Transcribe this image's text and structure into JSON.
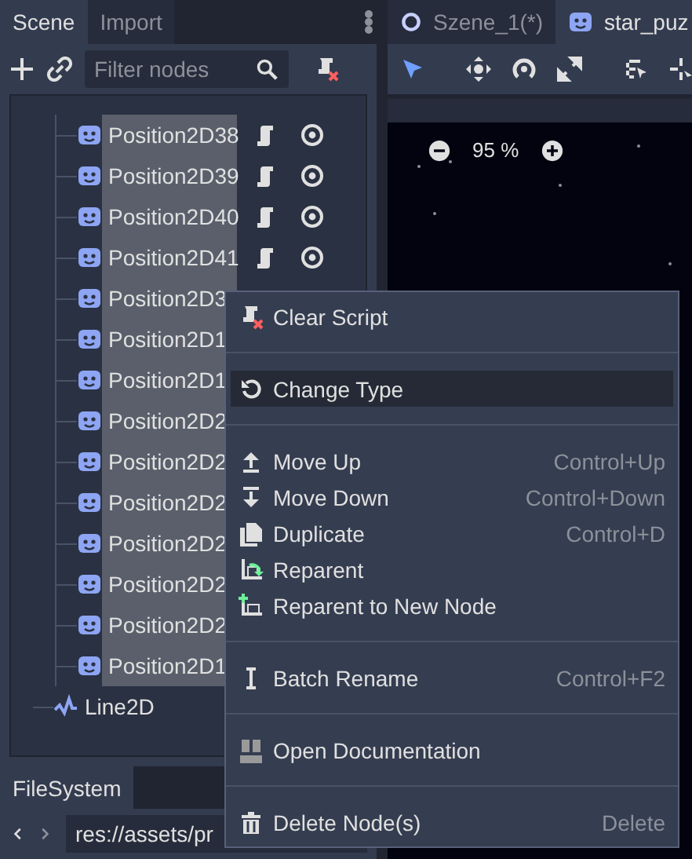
{
  "scene_panel": {
    "tabs": [
      {
        "label": "Scene",
        "selected": true
      },
      {
        "label": "Import",
        "selected": false
      }
    ],
    "filter": {
      "placeholder": "Filter nodes"
    },
    "tree": [
      {
        "kind": "group",
        "children": [
          {
            "name": "Position2D38",
            "selected": true,
            "script": true,
            "visible": true
          },
          {
            "name": "Position2D39",
            "selected": true,
            "script": true,
            "visible": true
          },
          {
            "name": "Position2D40",
            "selected": true,
            "script": true,
            "visible": true
          },
          {
            "name": "Position2D41",
            "selected": true,
            "script": true,
            "visible": true
          },
          {
            "name": "Position2D3",
            "selected": true
          },
          {
            "name": "Position2D1",
            "selected": true
          },
          {
            "name": "Position2D1",
            "selected": true
          },
          {
            "name": "Position2D2",
            "selected": true
          },
          {
            "name": "Position2D2",
            "selected": true
          },
          {
            "name": "Position2D2",
            "selected": true
          },
          {
            "name": "Position2D2",
            "selected": true
          },
          {
            "name": "Position2D2",
            "selected": true
          },
          {
            "name": "Position2D2",
            "selected": true
          },
          {
            "name": "Position2D1",
            "selected": true
          }
        ]
      },
      {
        "kind": "line",
        "name": "Line2D",
        "selected": false
      }
    ]
  },
  "editor": {
    "tabs": [
      {
        "label": "Szene_1(*)",
        "kind": "scene",
        "selected": false
      },
      {
        "label": "star_puz",
        "kind": "node",
        "selected": true
      }
    ],
    "tools": [
      {
        "selected": true
      },
      {
        "selected": false
      },
      {
        "selected": false
      },
      {
        "selected": false
      },
      {
        "selected": false
      },
      {
        "selected": false
      }
    ],
    "zoom": "95 %"
  },
  "filesystem": {
    "tab": "FileSystem",
    "path": "res://assets/pr"
  },
  "context_menu": [
    {
      "kind": "item",
      "label": "Clear Script",
      "selected": false
    },
    {
      "kind": "separator"
    },
    {
      "kind": "item",
      "label": "Change Type",
      "selected": true
    },
    {
      "kind": "separator"
    },
    {
      "kind": "item",
      "label": "Move Up",
      "shortcut": "Control+Up",
      "selected": false
    },
    {
      "kind": "item",
      "label": "Move Down",
      "shortcut": "Control+Down",
      "selected": false
    },
    {
      "kind": "item",
      "label": "Duplicate",
      "shortcut": "Control+D",
      "selected": false
    },
    {
      "kind": "item",
      "label": "Reparent",
      "selected": false
    },
    {
      "kind": "item",
      "label": "Reparent to New Node",
      "selected": false
    },
    {
      "kind": "separator"
    },
    {
      "kind": "item",
      "label": "Batch Rename",
      "shortcut": "Control+F2",
      "selected": false
    },
    {
      "kind": "separator"
    },
    {
      "kind": "item",
      "label": "Open Documentation",
      "selected": false
    },
    {
      "kind": "separator"
    },
    {
      "kind": "item",
      "label": "Delete Node(s)",
      "shortcut": "Delete",
      "selected": false
    }
  ]
}
